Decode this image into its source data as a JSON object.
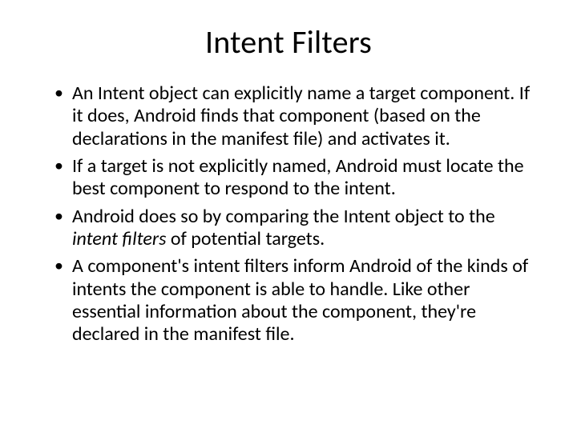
{
  "slide": {
    "title": "Intent Filters",
    "bullets": [
      {
        "text": "An Intent object can explicitly name a target component. If it does, Android finds that component (based on the declarations in the manifest file) and activates it."
      },
      {
        "text": "If a target is not explicitly named, Android must locate the best component to respond to the intent."
      },
      {
        "prefix": "Android does so by comparing the Intent object to the ",
        "emph": "intent filters",
        "suffix": " of potential targets."
      },
      {
        "text": "A component's intent filters inform Android of the kinds of intents the component is able to handle. Like other essential information about the component, they're declared in the manifest file."
      }
    ]
  }
}
